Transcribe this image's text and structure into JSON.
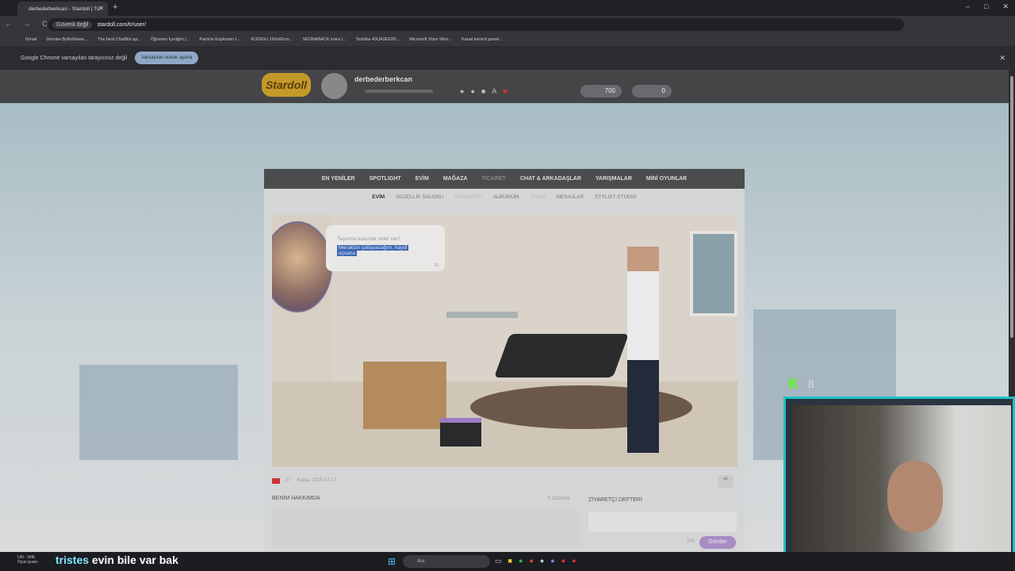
{
  "browser": {
    "tab_title": "derbederberkcan - Stardoll | Tü",
    "security": "Güvenli değil",
    "url": "stardoll.com/tr/user/",
    "nav_icons": "← → C",
    "new_tab": "+",
    "win_buttons": [
      "–",
      "□",
      "✕"
    ]
  },
  "bookmarks": [
    "Gmail",
    "Dorrate ByNoName...",
    "The best ChatBot ap...",
    "Öğrenim İçeriğim |...",
    "Particle Explosion L...",
    "KODIGU 160x60cm...",
    "SKDNABACK knira I...",
    "Toshiba 43UA3E63D...",
    "Microsoft Xbox Wire...",
    "Kanal kontrol panel..."
  ],
  "infobar": {
    "text": "Google Chrome varsayılan tarayıcınız değil",
    "button": "Varsayılan olarak ayarla",
    "close": "✕"
  },
  "stardoll": {
    "logo": "Stardoll",
    "username": "derbederberkcan",
    "stars": "700",
    "coins": "0"
  },
  "main_nav": [
    "EN YENİLER",
    "SPOTLIGHT",
    "EVİM",
    "MAĞAZA",
    "TICARET",
    "CHAT & ARKADAŞLAR",
    "YARIŞMALAR",
    "MİNİ OYUNLAR"
  ],
  "sub_nav": [
    "EVİM",
    "GÜZELLİK SALONU",
    "GARDIROP",
    "ALBÜMÜM",
    "TAKIM",
    "MESAJLAR",
    "STYLIST STUDIO"
  ],
  "bubble": {
    "line1": "Taşınma kutunda neler var?",
    "line2": "Meraktan çatlayacağım, haydi",
    "line3": "açsana",
    "num": "26"
  },
  "profile": {
    "age": "27",
    "joined": "Katıla: 2025-07-17",
    "about_title": "BENİM HAKKIMDA",
    "edit": "Düzenle",
    "guestbook": "ZİYARETÇİ DEFTERİ",
    "count": "250",
    "send": "Gönder"
  },
  "stream": {
    "kick_count": "8",
    "sub_name": "tristes",
    "sub_text": "evin bile var bak"
  },
  "taskbar": {
    "weather_line1": "LIN - SHE",
    "weather_line2": "Oyun puanı",
    "search": "Ara"
  }
}
